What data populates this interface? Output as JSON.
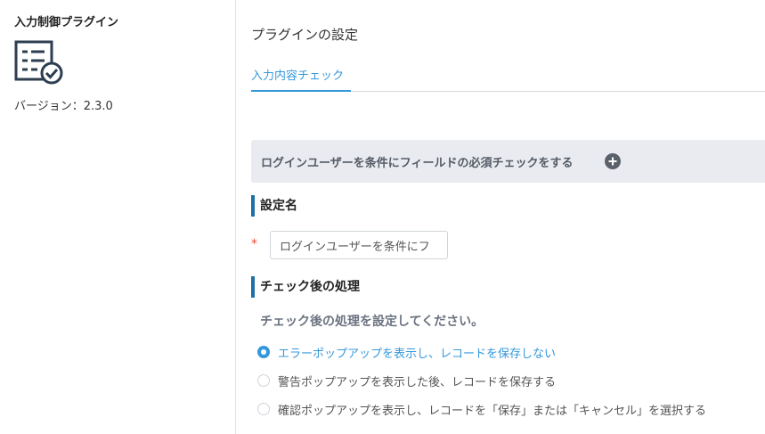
{
  "plugin": {
    "name": "入力制御プラグイン",
    "version": "バージョン：2.3.0"
  },
  "settings": {
    "title": "プラグインの設定",
    "tabs": [
      {
        "label": "入力内容チェック",
        "active": true
      }
    ]
  },
  "section": {
    "header": "ログインユーザーを条件にフィールドの必須チェックをする"
  },
  "setting_name": {
    "title": "設定名",
    "required_mark": "*",
    "value": "ログインユーザーを条件にフ"
  },
  "post_check": {
    "title": "チェック後の処理",
    "instruction": "チェック後の処理を設定してください。",
    "options": [
      {
        "label": "エラーポップアップを表示し、レコードを保存しない",
        "checked": true
      },
      {
        "label": "警告ポップアップを表示した後、レコードを保存する",
        "checked": false
      },
      {
        "label": "確認ポップアップを表示し、レコードを「保存」または「キャンセル」を選択する",
        "checked": false
      }
    ]
  },
  "colors": {
    "accent": "#3498db",
    "section_bar": "#1d6fa5",
    "header_bg": "#e9ebf0",
    "required": "#e74c3c"
  },
  "icons": {
    "plugin": "checklist-icon",
    "add": "plus-circle-icon"
  }
}
